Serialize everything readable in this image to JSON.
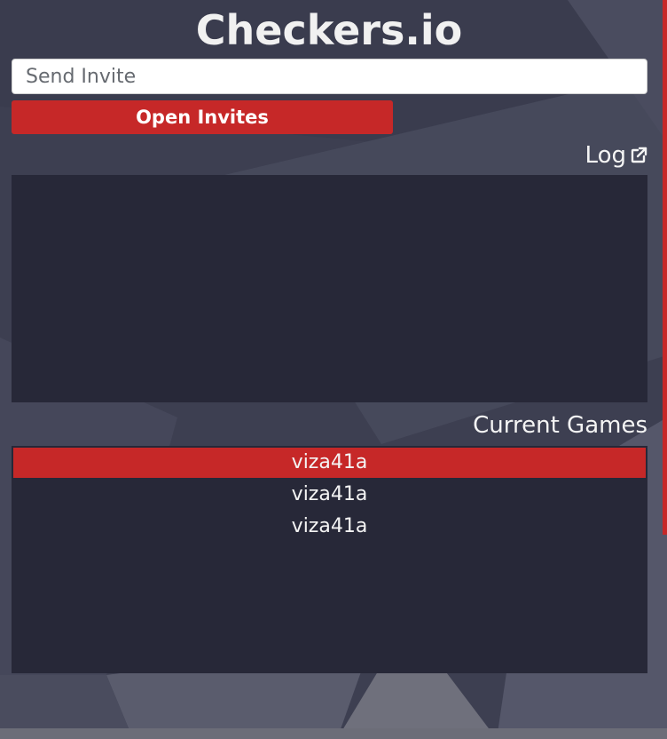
{
  "app": {
    "title": "Checkers.io"
  },
  "invite": {
    "placeholder": "Send Invite",
    "value": ""
  },
  "open_invites": {
    "label": "Open Invites"
  },
  "log": {
    "label": "Log",
    "icon": "external-link-icon"
  },
  "current_games": {
    "label": "Current Games",
    "items": [
      {
        "name": "viza41a",
        "selected": true
      },
      {
        "name": "viza41a",
        "selected": false
      },
      {
        "name": "viza41a",
        "selected": false
      }
    ]
  },
  "colors": {
    "accent": "#c62828",
    "panel": "#272838",
    "background": "#3f4153"
  }
}
